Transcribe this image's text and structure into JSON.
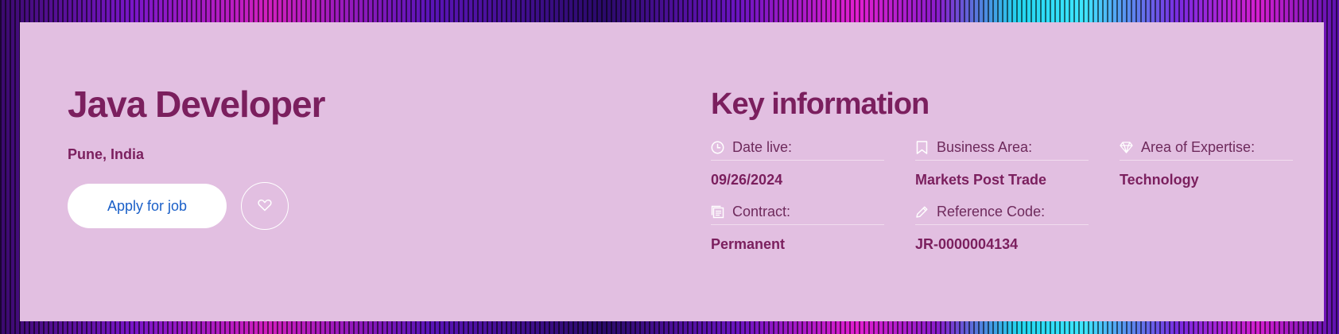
{
  "job": {
    "title": "Java Developer",
    "location": "Pune, India",
    "apply_label": "Apply for job"
  },
  "key_info": {
    "title": "Key information",
    "items": [
      {
        "icon": "clock-icon",
        "label": "Date live:",
        "value": "09/26/2024"
      },
      {
        "icon": "bookmark-icon",
        "label": "Business Area:",
        "value": "Markets Post Trade"
      },
      {
        "icon": "diamond-icon",
        "label": "Area of Expertise:",
        "value": "Technology"
      },
      {
        "icon": "document-icon",
        "label": "Contract:",
        "value": "Permanent"
      },
      {
        "icon": "pencil-icon",
        "label": "Reference Code:",
        "value": "JR-0000004134"
      }
    ]
  },
  "colors": {
    "card_background": "#e2bfe1",
    "heading": "#7b1f5e",
    "apply_text": "#1a5fc8"
  }
}
